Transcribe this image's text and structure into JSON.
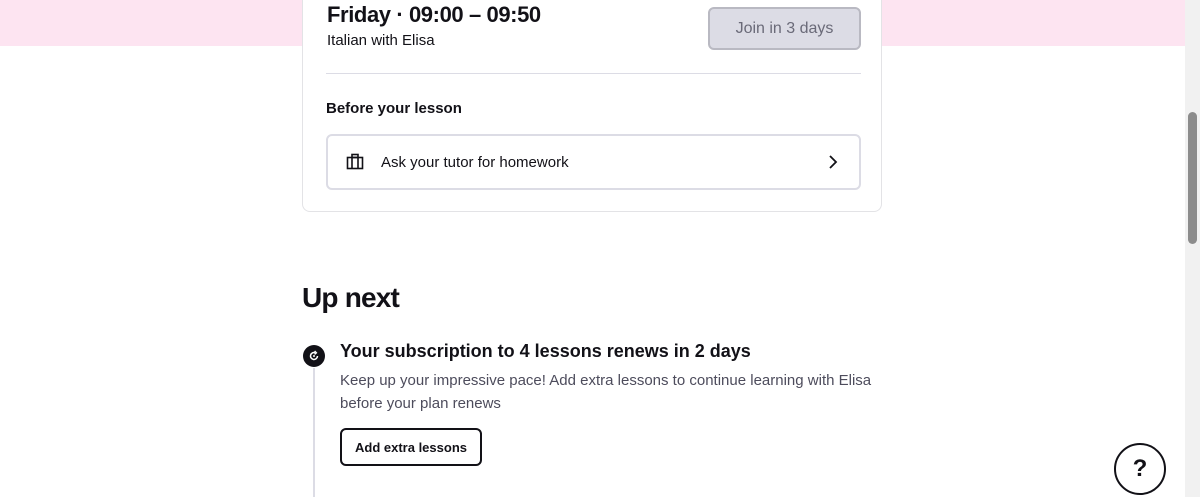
{
  "lesson": {
    "time_title": "Friday · 09:00 – 09:50",
    "subtitle": "Italian with Elisa",
    "join_label": "Join in 3 days",
    "before_title": "Before your lesson",
    "homework_label": "Ask your tutor for homework"
  },
  "up_next": {
    "heading": "Up next",
    "title": "Your subscription to 4 lessons renews in 2 days",
    "description": "Keep up your impressive pace! Add extra lessons to continue learning with Elisa before your plan renews",
    "button_label": "Add extra lessons"
  },
  "help": {
    "label": "?"
  },
  "icons": {
    "homework": "briefcase-icon",
    "chevron": "chevron-right-icon",
    "timeline": "renew-icon"
  },
  "colors": {
    "band": "#fde4f1",
    "text": "#121117",
    "join_bg": "#dcdce5",
    "border": "#dcdce5"
  }
}
